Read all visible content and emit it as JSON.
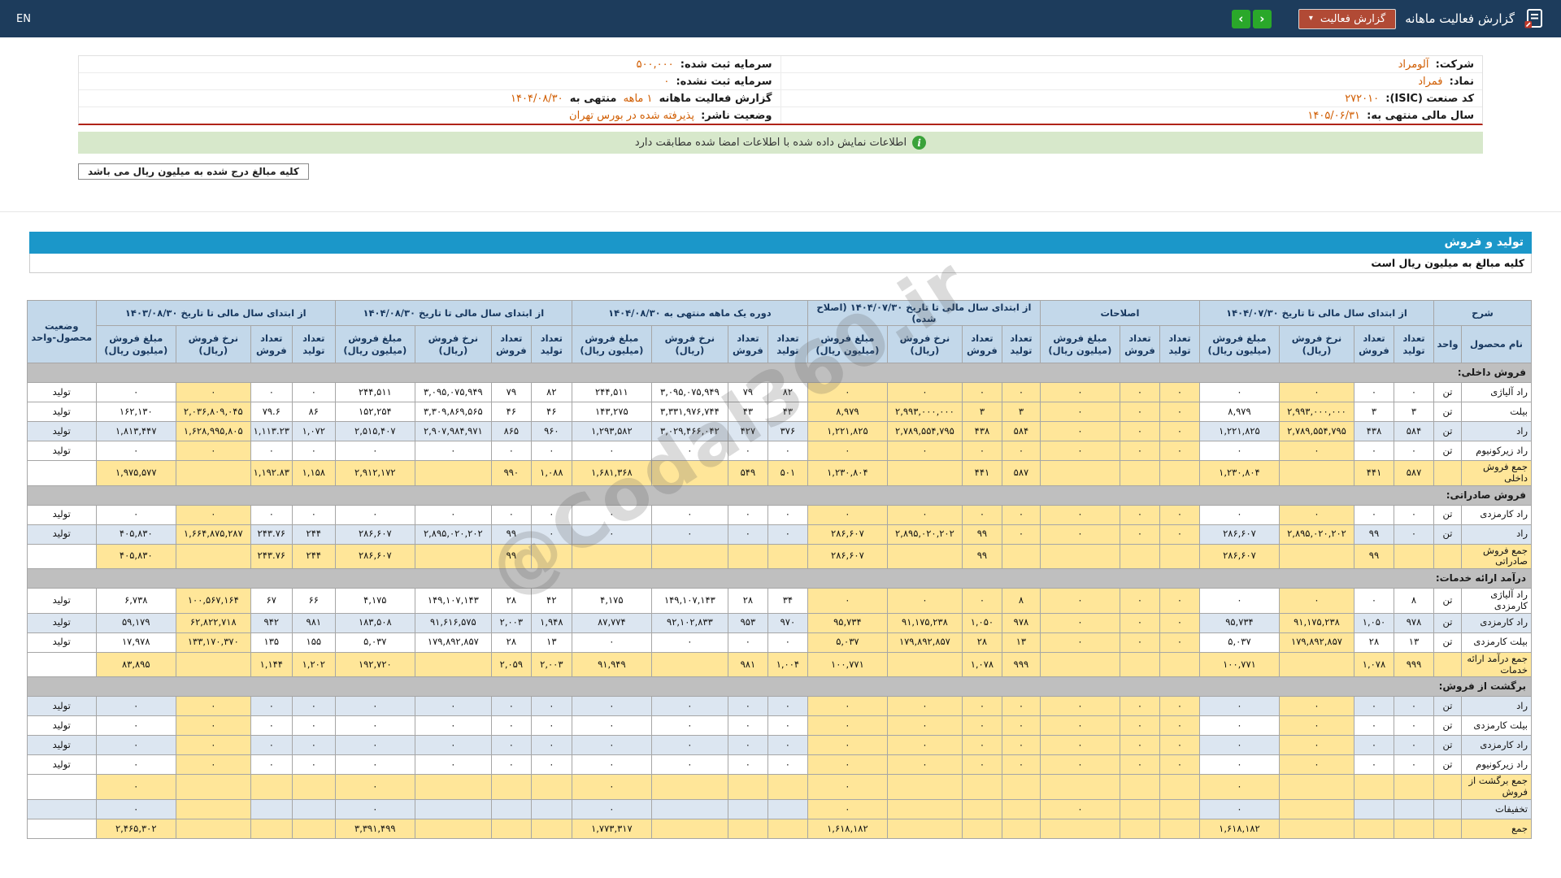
{
  "colors": {
    "topbar_bg": "#1d3c5c",
    "section_bar_blue": "#1b97c9",
    "highlight_yellow": "#ffe699",
    "alt_row_blue": "#dce6f1",
    "header_cell_blue": "#c3d8ea",
    "section_row_gray": "#bfbfbf",
    "alert_green": "#d7e8cb",
    "value_orange": "#d05c00",
    "report_button_red": "#b14a35",
    "arrow_green": "#2aa82a",
    "divider_red": "#b02318"
  },
  "icons": {
    "chevron_down": "▾",
    "nav_left": "‹",
    "nav_right": "›",
    "info": "i"
  },
  "topbar": {
    "title": "گزارش فعالیت ماهانه",
    "report_button": "گزارش فعالیت",
    "lang": "EN"
  },
  "info": {
    "rows": [
      {
        "right_label": "شرکت:",
        "right_value": "آلومراد",
        "left_label": "سرمایه ثبت شده:",
        "left_value": "۵۰۰,۰۰۰"
      },
      {
        "right_label": "نماد:",
        "right_value": "فمراد",
        "left_label": "سرمایه ثبت نشده:",
        "left_value": "۰"
      },
      {
        "right_label": "کد صنعت (ISIC):",
        "right_value": "۲۷۲۰۱۰",
        "left_label": "گزارش فعالیت ماهانه",
        "left_value": "۱ ماهه",
        "left_mid": "منتهی به",
        "left_value2": "۱۴۰۴/۰۸/۳۰"
      },
      {
        "right_label": "سال مالی منتهی به:",
        "right_value": "۱۴۰۵/۰۶/۳۱",
        "left_label": "وضعیت ناشر:",
        "left_value": "پذیرفته شده در بورس تهران"
      }
    ]
  },
  "alert": {
    "text": "اطلاعات نمایش داده شده با اطلاعات امضا شده مطابقت دارد"
  },
  "notes": {
    "amounts_note": "کلیه مبالغ درج شده به میلیون ریال می باشد",
    "section_title": "تولید و فروش",
    "table_note": "کلیه مبالغ به میلیون ریال است"
  },
  "watermark": "@Codal360.ir",
  "table": {
    "groups": [
      {
        "title": "شرح",
        "subs": [
          "نام محصول",
          "واحد"
        ],
        "widths": [
          86,
          34
        ]
      },
      {
        "title": "از ابتدای سال مالی تا تاریخ ۱۴۰۴/۰۷/۳۰",
        "subs": [
          "تعداد تولید",
          "تعداد فروش",
          "نرخ فروش (ریال)",
          "مبلغ فروش (میلیون ریال)"
        ],
        "widths": [
          49,
          49,
          92,
          98
        ]
      },
      {
        "title": "اصلاحات",
        "subs": [
          "تعداد تولید",
          "تعداد فروش",
          "مبلغ فروش (میلیون ریال)"
        ],
        "widths": [
          49,
          49,
          98
        ]
      },
      {
        "title": "از ابتدای سال مالی تا تاریخ ۱۴۰۴/۰۷/۳۰ (اصلاح شده)",
        "subs": [
          "تعداد تولید",
          "تعداد فروش",
          "نرخ فروش (ریال)",
          "مبلغ فروش (میلیون ریال)"
        ],
        "widths": [
          47,
          49,
          92,
          98
        ]
      },
      {
        "title": "دوره یک ماهه منتهی به ۱۴۰۴/۰۸/۳۰",
        "subs": [
          "تعداد تولید",
          "تعداد فروش",
          "نرخ فروش (ریال)",
          "مبلغ فروش (میلیون ریال)"
        ],
        "widths": [
          49,
          49,
          94,
          98
        ]
      },
      {
        "title": "از ابتدای سال مالی تا تاریخ ۱۴۰۴/۰۸/۳۰",
        "subs": [
          "تعداد تولید",
          "تعداد فروش",
          "نرخ فروش (ریال)",
          "مبلغ فروش (میلیون ریال)"
        ],
        "widths": [
          50,
          49,
          94,
          98
        ]
      },
      {
        "title": "از ابتدای سال مالی تا تاریخ ۱۴۰۳/۰۸/۳۰",
        "subs": [
          "تعداد تولید",
          "تعداد فروش",
          "نرخ فروش (ریال)",
          "مبلغ فروش (میلیون ریال)"
        ],
        "widths": [
          53,
          51,
          92,
          98
        ]
      },
      {
        "title": "وضعیت محصول-واحد",
        "subs": [],
        "widths": [
          85
        ]
      }
    ],
    "default_hl": [
      2,
      4,
      5,
      6,
      7,
      8,
      9,
      10,
      21
    ],
    "rows": [
      {
        "type": "section",
        "label": "فروش داخلی:"
      },
      {
        "type": "data",
        "name": "راد آلیاژی",
        "unit": "تن",
        "alt": false,
        "status": "تولید",
        "cells": [
          "۰",
          "۰",
          "۰",
          "۰",
          "۰",
          "۰",
          "۰",
          "۰",
          "۰",
          "۰",
          "۰",
          "۸۲",
          "۷۹",
          "۳,۰۹۵,۰۷۵,۹۴۹",
          "۲۴۴,۵۱۱",
          "۸۲",
          "۷۹",
          "۳,۰۹۵,۰۷۵,۹۴۹",
          "۲۴۴,۵۱۱",
          "۰",
          "۰",
          "۰",
          "۰"
        ]
      },
      {
        "type": "data",
        "name": "بیلت",
        "unit": "تن",
        "alt": false,
        "status": "تولید",
        "cells": [
          "۳",
          "۳",
          "۲,۹۹۳,۰۰۰,۰۰۰",
          "۸,۹۷۹",
          "۰",
          "۰",
          "۰",
          "۳",
          "۳",
          "۲,۹۹۳,۰۰۰,۰۰۰",
          "۸,۹۷۹",
          "۴۳",
          "۴۳",
          "۳,۳۳۱,۹۷۶,۷۴۴",
          "۱۴۳,۲۷۵",
          "۴۶",
          "۴۶",
          "۳,۳۰۹,۸۶۹,۵۶۵",
          "۱۵۲,۲۵۴",
          "۸۶",
          "۷۹.۶",
          "۲,۰۳۶,۸۰۹,۰۴۵",
          "۱۶۲,۱۳۰"
        ]
      },
      {
        "type": "data",
        "name": "راد",
        "unit": "تن",
        "alt": true,
        "status": "تولید",
        "cells": [
          "۵۸۴",
          "۴۳۸",
          "۲,۷۸۹,۵۵۴,۷۹۵",
          "۱,۲۲۱,۸۲۵",
          "۰",
          "۰",
          "۰",
          "۵۸۴",
          "۴۳۸",
          "۲,۷۸۹,۵۵۴,۷۹۵",
          "۱,۲۲۱,۸۲۵",
          "۳۷۶",
          "۴۲۷",
          "۳,۰۲۹,۴۶۶,۰۴۲",
          "۱,۲۹۳,۵۸۲",
          "۹۶۰",
          "۸۶۵",
          "۲,۹۰۷,۹۸۴,۹۷۱",
          "۲,۵۱۵,۴۰۷",
          "۱,۰۷۲",
          "۱,۱۱۳.۲۳",
          "۱,۶۲۸,۹۹۵,۸۰۵",
          "۱,۸۱۳,۴۴۷"
        ]
      },
      {
        "type": "data",
        "name": "راد زیرکونیوم",
        "unit": "تن",
        "alt": false,
        "status": "تولید",
        "cells": [
          "۰",
          "۰",
          "۰",
          "۰",
          "۰",
          "۰",
          "۰",
          "۰",
          "۰",
          "۰",
          "۰",
          "۰",
          "۰",
          "۰",
          "۰",
          "۰",
          "۰",
          "۰",
          "۰",
          "۰",
          "۰",
          "۰",
          "۰"
        ]
      },
      {
        "type": "sum",
        "name": "جمع فروش داخلی",
        "unit": "",
        "status": "",
        "cells": [
          "۵۸۷",
          "۴۴۱",
          "",
          "۱,۲۳۰,۸۰۴",
          "",
          "",
          "",
          "۵۸۷",
          "۴۴۱",
          "",
          "۱,۲۳۰,۸۰۴",
          "۵۰۱",
          "۵۴۹",
          "",
          "۱,۶۸۱,۳۶۸",
          "۱,۰۸۸",
          "۹۹۰",
          "",
          "۲,۹۱۲,۱۷۲",
          "۱,۱۵۸",
          "۱,۱۹۲.۸۳",
          "",
          "۱,۹۷۵,۵۷۷"
        ]
      },
      {
        "type": "section",
        "label": "فروش صادراتی:"
      },
      {
        "type": "data",
        "name": "راد کارمزدی",
        "unit": "تن",
        "alt": false,
        "status": "تولید",
        "cells": [
          "۰",
          "۰",
          "۰",
          "۰",
          "۰",
          "۰",
          "۰",
          "۰",
          "۰",
          "۰",
          "۰",
          "۰",
          "۰",
          "۰",
          "۰",
          "۰",
          "۰",
          "۰",
          "۰",
          "۰",
          "۰",
          "۰",
          "۰"
        ]
      },
      {
        "type": "data",
        "name": "راد",
        "unit": "تن",
        "alt": true,
        "status": "تولید",
        "cells": [
          "۰",
          "۹۹",
          "۲,۸۹۵,۰۲۰,۲۰۲",
          "۲۸۶,۶۰۷",
          "۰",
          "۰",
          "۰",
          "۰",
          "۹۹",
          "۲,۸۹۵,۰۲۰,۲۰۲",
          "۲۸۶,۶۰۷",
          "۰",
          "۰",
          "۰",
          "۰",
          "۰",
          "۹۹",
          "۲,۸۹۵,۰۲۰,۲۰۲",
          "۲۸۶,۶۰۷",
          "۲۴۴",
          "۲۴۳.۷۶",
          "۱,۶۶۴,۸۷۵,۲۸۷",
          "۴۰۵,۸۳۰"
        ]
      },
      {
        "type": "sum",
        "name": "جمع فروش صادراتی",
        "unit": "",
        "status": "",
        "cells": [
          "",
          "۹۹",
          "",
          "۲۸۶,۶۰۷",
          "",
          "",
          "",
          "",
          "۹۹",
          "",
          "۲۸۶,۶۰۷",
          "",
          "",
          "",
          "",
          "",
          "۹۹",
          "",
          "۲۸۶,۶۰۷",
          "۲۴۴",
          "۲۴۳.۷۶",
          "",
          "۴۰۵,۸۳۰"
        ]
      },
      {
        "type": "section",
        "label": "درآمد ارائه خدمات:"
      },
      {
        "type": "data",
        "name": "راد آلیاژی کارمزدی",
        "unit": "تن",
        "alt": false,
        "status": "تولید",
        "cells": [
          "۸",
          "۰",
          "۰",
          "۰",
          "۰",
          "۰",
          "۰",
          "۸",
          "۰",
          "۰",
          "۰",
          "۳۴",
          "۲۸",
          "۱۴۹,۱۰۷,۱۴۳",
          "۴,۱۷۵",
          "۴۲",
          "۲۸",
          "۱۴۹,۱۰۷,۱۴۳",
          "۴,۱۷۵",
          "۶۶",
          "۶۷",
          "۱۰۰,۵۶۷,۱۶۴",
          "۶,۷۳۸"
        ]
      },
      {
        "type": "data",
        "name": "راد کارمزدی",
        "unit": "تن",
        "alt": true,
        "status": "تولید",
        "cells": [
          "۹۷۸",
          "۱,۰۵۰",
          "۹۱,۱۷۵,۲۳۸",
          "۹۵,۷۳۴",
          "۰",
          "۰",
          "۰",
          "۹۷۸",
          "۱,۰۵۰",
          "۹۱,۱۷۵,۲۳۸",
          "۹۵,۷۳۴",
          "۹۷۰",
          "۹۵۳",
          "۹۲,۱۰۲,۸۳۳",
          "۸۷,۷۷۴",
          "۱,۹۴۸",
          "۲,۰۰۳",
          "۹۱,۶۱۶,۵۷۵",
          "۱۸۳,۵۰۸",
          "۹۸۱",
          "۹۴۲",
          "۶۲,۸۲۲,۷۱۸",
          "۵۹,۱۷۹"
        ]
      },
      {
        "type": "data",
        "name": "بیلت کارمزدی",
        "unit": "تن",
        "alt": false,
        "status": "تولید",
        "cells": [
          "۱۳",
          "۲۸",
          "۱۷۹,۸۹۲,۸۵۷",
          "۵,۰۳۷",
          "۰",
          "۰",
          "۰",
          "۱۳",
          "۲۸",
          "۱۷۹,۸۹۲,۸۵۷",
          "۵,۰۳۷",
          "۰",
          "۰",
          "۰",
          "۰",
          "۱۳",
          "۲۸",
          "۱۷۹,۸۹۲,۸۵۷",
          "۵,۰۳۷",
          "۱۵۵",
          "۱۳۵",
          "۱۳۳,۱۷۰,۳۷۰",
          "۱۷,۹۷۸"
        ]
      },
      {
        "type": "sum",
        "name": "جمع درآمد ارائه خدمات",
        "unit": "",
        "status": "",
        "cells": [
          "۹۹۹",
          "۱,۰۷۸",
          "",
          "۱۰۰,۷۷۱",
          "",
          "",
          "",
          "۹۹۹",
          "۱,۰۷۸",
          "",
          "۱۰۰,۷۷۱",
          "۱,۰۰۴",
          "۹۸۱",
          "",
          "۹۱,۹۴۹",
          "۲,۰۰۳",
          "۲,۰۵۹",
          "",
          "۱۹۲,۷۲۰",
          "۱,۲۰۲",
          "۱,۱۴۴",
          "",
          "۸۳,۸۹۵"
        ]
      },
      {
        "type": "section",
        "label": "برگشت از فروش:"
      },
      {
        "type": "data",
        "name": "راد",
        "unit": "تن",
        "alt": true,
        "status": "تولید",
        "cells": [
          "۰",
          "۰",
          "۰",
          "۰",
          "۰",
          "۰",
          "۰",
          "۰",
          "۰",
          "۰",
          "۰",
          "۰",
          "۰",
          "۰",
          "۰",
          "۰",
          "۰",
          "۰",
          "۰",
          "۰",
          "۰",
          "۰",
          "۰"
        ]
      },
      {
        "type": "data",
        "name": "بیلت کارمزدی",
        "unit": "تن",
        "alt": false,
        "status": "تولید",
        "cells": [
          "۰",
          "۰",
          "۰",
          "۰",
          "۰",
          "۰",
          "۰",
          "۰",
          "۰",
          "۰",
          "۰",
          "۰",
          "۰",
          "۰",
          "۰",
          "۰",
          "۰",
          "۰",
          "۰",
          "۰",
          "۰",
          "۰",
          "۰"
        ]
      },
      {
        "type": "data",
        "name": "راد کارمزدی",
        "unit": "تن",
        "alt": true,
        "status": "تولید",
        "cells": [
          "۰",
          "۰",
          "۰",
          "۰",
          "۰",
          "۰",
          "۰",
          "۰",
          "۰",
          "۰",
          "۰",
          "۰",
          "۰",
          "۰",
          "۰",
          "۰",
          "۰",
          "۰",
          "۰",
          "۰",
          "۰",
          "۰",
          "۰"
        ]
      },
      {
        "type": "data",
        "name": "راد زیرکونیوم",
        "unit": "تن",
        "alt": false,
        "status": "تولید",
        "cells": [
          "۰",
          "۰",
          "۰",
          "۰",
          "۰",
          "۰",
          "۰",
          "۰",
          "۰",
          "۰",
          "۰",
          "۰",
          "۰",
          "۰",
          "۰",
          "۰",
          "۰",
          "۰",
          "۰",
          "۰",
          "۰",
          "۰",
          "۰"
        ]
      },
      {
        "type": "sum",
        "name": "جمع برگشت از فروش",
        "unit": "",
        "status": "",
        "cells": [
          "",
          "",
          "",
          "۰",
          "",
          "",
          "",
          "",
          "",
          "",
          "۰",
          "",
          "",
          "",
          "۰",
          "",
          "",
          "",
          "۰",
          "",
          "",
          "",
          "۰"
        ]
      },
      {
        "type": "data",
        "name": "تخفیفات",
        "unit": "",
        "alt": true,
        "status": "",
        "cells": [
          "",
          "",
          "",
          "۰",
          "",
          "",
          "۰",
          "",
          "",
          "",
          "۰",
          "",
          "",
          "",
          "۰",
          "",
          "",
          "",
          "۰",
          "",
          "",
          "",
          "۰"
        ]
      },
      {
        "type": "sum",
        "name": "جمع",
        "unit": "",
        "status": "",
        "cells": [
          "",
          "",
          "",
          "۱,۶۱۸,۱۸۲",
          "",
          "",
          "",
          "",
          "",
          "",
          "۱,۶۱۸,۱۸۲",
          "",
          "",
          "",
          "۱,۷۷۳,۳۱۷",
          "",
          "",
          "",
          "۳,۳۹۱,۴۹۹",
          "",
          "",
          "",
          "۲,۴۶۵,۳۰۲"
        ]
      }
    ]
  }
}
